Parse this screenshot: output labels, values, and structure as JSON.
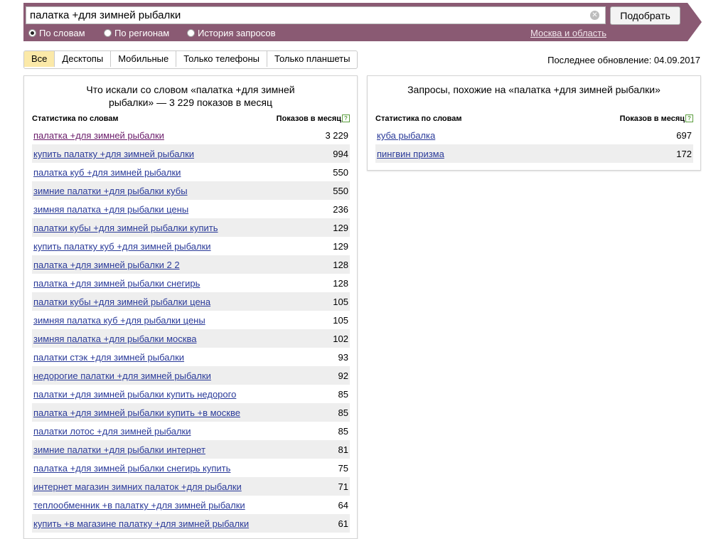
{
  "search": {
    "value": "палатка +для зимней рыбалки",
    "submit_label": "Подобрать",
    "modes": [
      {
        "label": "По словам",
        "selected": true
      },
      {
        "label": "По регионам",
        "selected": false
      },
      {
        "label": "История запросов",
        "selected": false
      }
    ],
    "region": "Москва и область"
  },
  "tabs": [
    "Все",
    "Десктопы",
    "Мобильные",
    "Только телефоны",
    "Только планшеты"
  ],
  "active_tab": "Все",
  "last_update": "Последнее обновление: 04.09.2017",
  "left_panel": {
    "title_line1": "Что искали со словом «палатка +для зимней",
    "title_line2": "рыбалки» — 3 229 показов в месяц",
    "col_left": "Статистика по словам",
    "col_right": "Показов в месяц",
    "rows": [
      {
        "q": "палатка +для зимней рыбалки",
        "n": "3 229"
      },
      {
        "q": "купить палатку +для зимней рыбалки",
        "n": "994"
      },
      {
        "q": "палатка куб +для зимней рыбалки",
        "n": "550"
      },
      {
        "q": "зимние палатки +для рыбалки кубы",
        "n": "550"
      },
      {
        "q": "зимняя палатка +для рыбалки цены",
        "n": "236"
      },
      {
        "q": "палатки кубы +для зимней рыбалки купить",
        "n": "129"
      },
      {
        "q": "купить палатку куб +для зимней рыбалки",
        "n": "129"
      },
      {
        "q": "палатка +для зимней рыбалки 2 2",
        "n": "128"
      },
      {
        "q": "палатка +для зимней рыбалки снегирь",
        "n": "128"
      },
      {
        "q": "палатки кубы +для зимней рыбалки цена",
        "n": "105"
      },
      {
        "q": "зимняя палатка куб +для рыбалки цены",
        "n": "105"
      },
      {
        "q": "зимняя палатка +для рыбалки москва",
        "n": "102"
      },
      {
        "q": "палатки стэк +для зимней рыбалки",
        "n": "93"
      },
      {
        "q": "недорогие палатки +для зимней рыбалки",
        "n": "92"
      },
      {
        "q": "палатки +для зимней рыбалки купить недорого",
        "n": "85"
      },
      {
        "q": "палатка +для зимней рыбалки купить +в москве",
        "n": "85"
      },
      {
        "q": "палатки лотос +для зимней рыбалки",
        "n": "85"
      },
      {
        "q": "зимние палатки +для рыбалки интернет",
        "n": "81"
      },
      {
        "q": "палатка +для зимней рыбалки снегирь купить",
        "n": "75"
      },
      {
        "q": "интернет магазин зимних палаток +для рыбалки",
        "n": "71"
      },
      {
        "q": "теплообменник +в палатку +для зимней рыбалки",
        "n": "64"
      },
      {
        "q": "купить +в магазине палатку +для зимней рыбалки",
        "n": "61"
      }
    ]
  },
  "right_panel": {
    "title": "Запросы, похожие на «палатка +для зимней рыбалки»",
    "col_left": "Статистика по словам",
    "col_right": "Показов в месяц",
    "rows": [
      {
        "q": "куба рыбалка",
        "n": "697"
      },
      {
        "q": "пингвин призма",
        "n": "172"
      }
    ]
  },
  "icons": {
    "clear": "clear-icon",
    "help": "help-icon"
  },
  "colors": {
    "header": "#8a5a73",
    "active_tab": "#fbe9a8",
    "link": "#2a3a99",
    "row_alt": "#eeeeee"
  }
}
